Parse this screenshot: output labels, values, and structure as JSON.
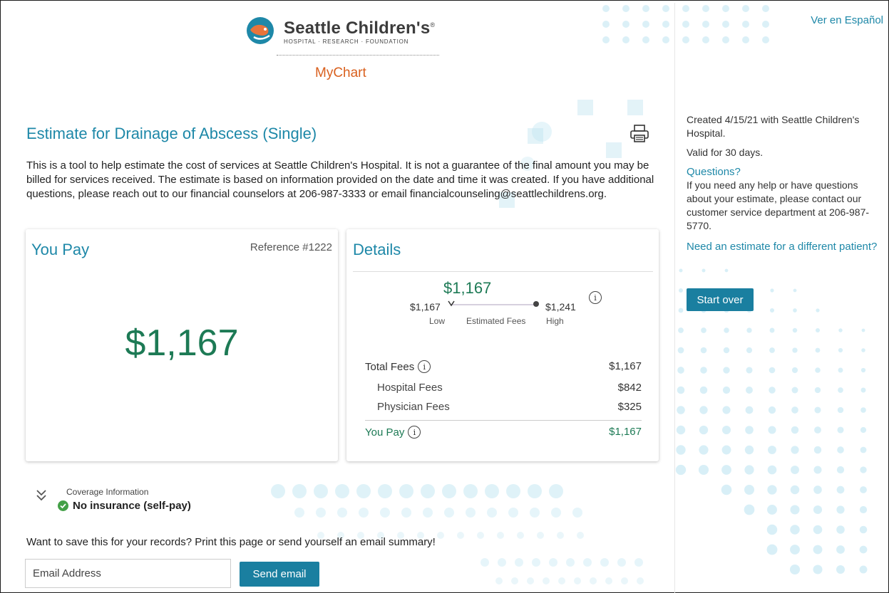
{
  "header": {
    "logo_name": "Seattle Children's",
    "logo_reg": "®",
    "logo_tagline": "HOSPITAL · RESEARCH · FOUNDATION",
    "app_name": "MyChart",
    "language_link": "Ver en Español"
  },
  "estimate": {
    "title": "Estimate for Drainage of Abscess (Single)",
    "intro": "This is a tool to help estimate the cost of services at Seattle Children's Hospital. It is not a guarantee of the final amount you may be billed for services received. The estimate is based on information provided on the date and time it was created. If you have additional questions, please reach out to our financial counselors at 206-987-3333 or email financialcounseling@seattlechildrens.org."
  },
  "you_pay_card": {
    "title": "You Pay",
    "reference": "Reference #1222",
    "amount": "$1,167"
  },
  "details_card": {
    "title": "Details",
    "range": {
      "estimate": "$1,167",
      "low_value": "$1,167",
      "high_value": "$1,241",
      "low_label": "Low",
      "mid_label": "Estimated Fees",
      "high_label": "High"
    },
    "fees": {
      "total_label": "Total Fees",
      "total_value": "$1,167",
      "hospital_label": "Hospital Fees",
      "hospital_value": "$842",
      "physician_label": "Physician Fees",
      "physician_value": "$325",
      "you_pay_label": "You Pay",
      "you_pay_value": "$1,167"
    }
  },
  "coverage": {
    "label": "Coverage Information",
    "value": "No insurance (self-pay)"
  },
  "save": {
    "text": "Want to save this for your records? Print this page or send yourself an email summary!",
    "email_placeholder": "Email Address",
    "send_label": "Send email"
  },
  "sidebar": {
    "created": "Created 4/15/21 with Seattle Children's Hospital.",
    "valid": "Valid for 30 days.",
    "questions_heading": "Questions?",
    "questions_text": "If you need any help or have questions about your estimate, please contact our customer service department at 206-987-5770.",
    "need_estimate": "Need an estimate for a different patient?",
    "start_over": "Start over"
  },
  "colors": {
    "accent": "#1e88a8",
    "money_green": "#1d7a55",
    "button": "#1a7fa0",
    "mychart_orange": "#d9601e"
  },
  "icons": [
    "seattle-childrens-logo-icon",
    "print-icon",
    "info-icon",
    "chevron-down-icon",
    "check-circle-icon"
  ]
}
